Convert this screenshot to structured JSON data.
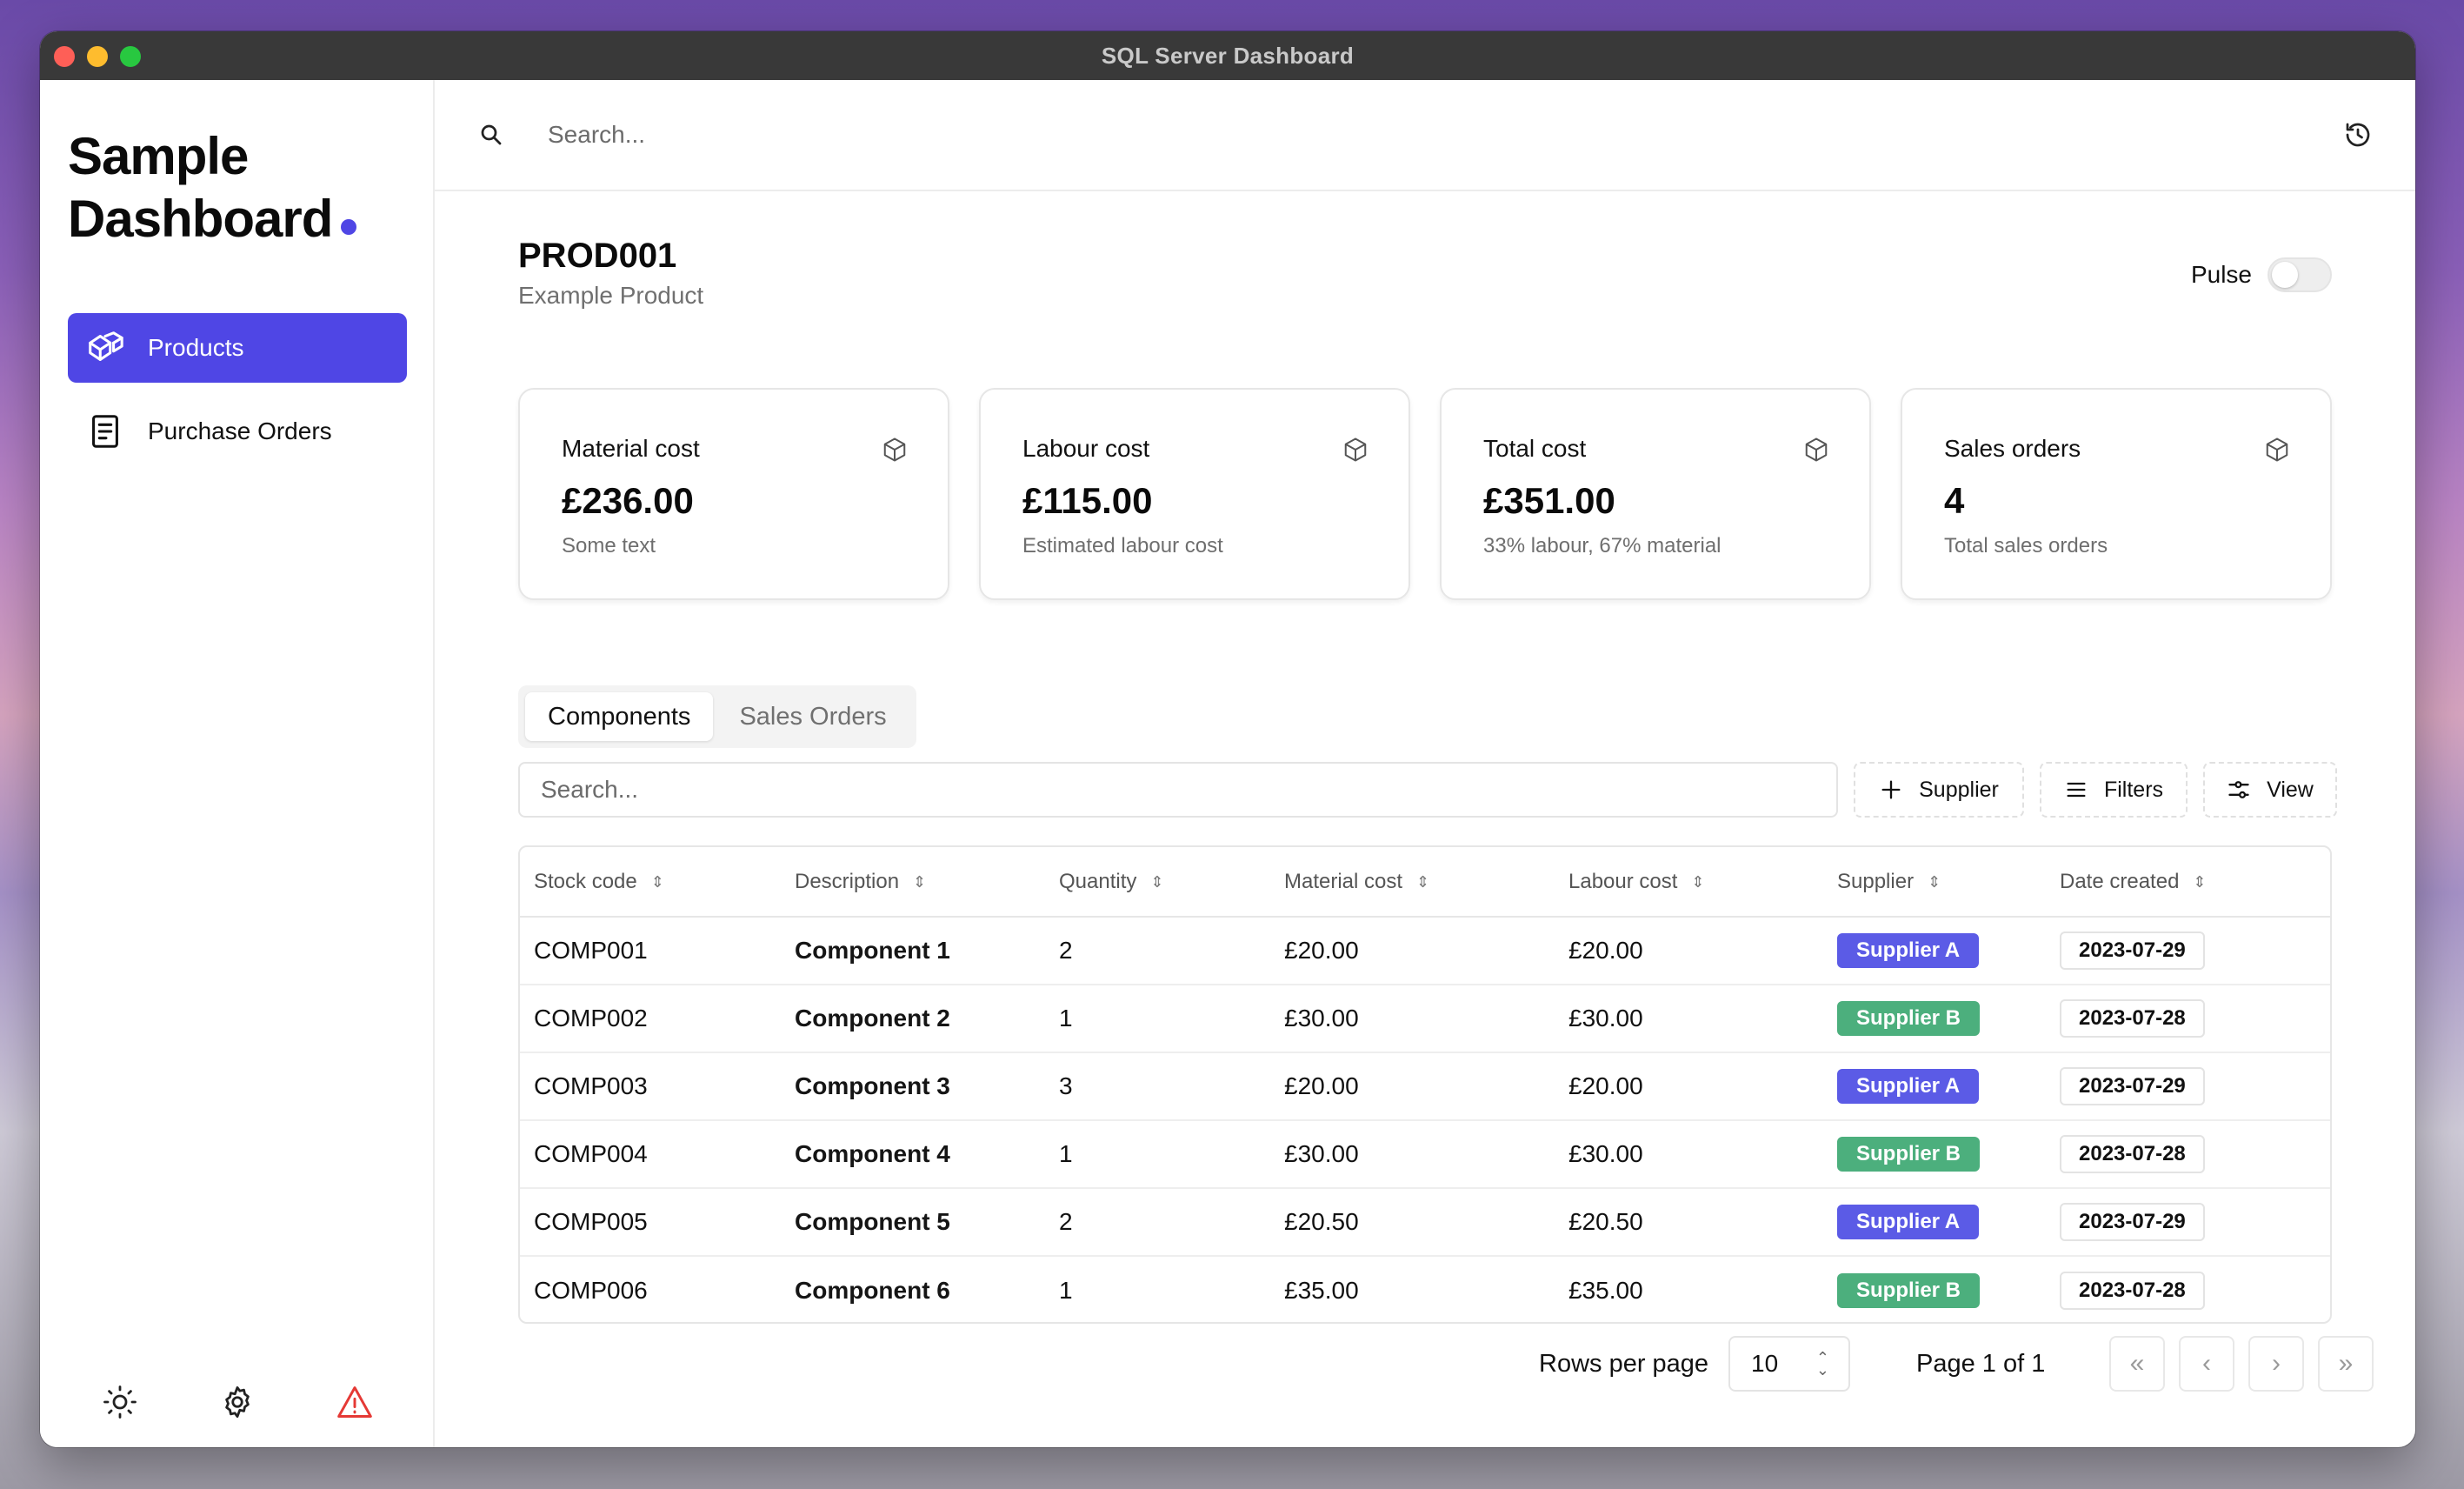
{
  "window": {
    "title": "SQL Server Dashboard"
  },
  "sidebar": {
    "brand_line1": "Sample",
    "brand_line2": "Dashboard",
    "items": [
      {
        "label": "Products",
        "icon": "box-stack-icon",
        "active": true
      },
      {
        "label": "Purchase Orders",
        "icon": "document-icon",
        "active": false
      }
    ],
    "footer_icons": [
      "sun-icon",
      "gear-icon",
      "warning-icon"
    ]
  },
  "topbar": {
    "search_placeholder": "Search..."
  },
  "product": {
    "code": "PROD001",
    "name": "Example Product",
    "pulse_label": "Pulse",
    "pulse_on": false
  },
  "cards": [
    {
      "label": "Material cost",
      "value": "£236.00",
      "sub": "Some text"
    },
    {
      "label": "Labour cost",
      "value": "£115.00",
      "sub": "Estimated labour cost"
    },
    {
      "label": "Total cost",
      "value": "£351.00",
      "sub": "33% labour, 67% material"
    },
    {
      "label": "Sales orders",
      "value": "4",
      "sub": "Total sales orders"
    }
  ],
  "tabs": [
    {
      "label": "Components",
      "active": true
    },
    {
      "label": "Sales Orders",
      "active": false
    }
  ],
  "table_tools": {
    "search_placeholder": "Search...",
    "supplier_label": "Supplier",
    "filters_label": "Filters",
    "view_label": "View"
  },
  "table": {
    "columns": [
      "Stock code",
      "Description",
      "Quantity",
      "Material cost",
      "Labour cost",
      "Supplier",
      "Date created"
    ],
    "rows": [
      {
        "code": "COMP001",
        "desc": "Component 1",
        "qty": "2",
        "mat": "£20.00",
        "lab": "£20.00",
        "supplier": "Supplier A",
        "date": "2023-07-29"
      },
      {
        "code": "COMP002",
        "desc": "Component 2",
        "qty": "1",
        "mat": "£30.00",
        "lab": "£30.00",
        "supplier": "Supplier B",
        "date": "2023-07-28"
      },
      {
        "code": "COMP003",
        "desc": "Component 3",
        "qty": "3",
        "mat": "£20.00",
        "lab": "£20.00",
        "supplier": "Supplier A",
        "date": "2023-07-29"
      },
      {
        "code": "COMP004",
        "desc": "Component 4",
        "qty": "1",
        "mat": "£30.00",
        "lab": "£30.00",
        "supplier": "Supplier B",
        "date": "2023-07-28"
      },
      {
        "code": "COMP005",
        "desc": "Component 5",
        "qty": "2",
        "mat": "£20.50",
        "lab": "£20.50",
        "supplier": "Supplier A",
        "date": "2023-07-29"
      },
      {
        "code": "COMP006",
        "desc": "Component 6",
        "qty": "1",
        "mat": "£35.00",
        "lab": "£35.00",
        "supplier": "Supplier B",
        "date": "2023-07-28"
      }
    ]
  },
  "pagination": {
    "rows_per_page_label": "Rows per page",
    "rows_per_page": "10",
    "page_label": "Page 1 of 1"
  },
  "colors": {
    "accent": "#4f46e5",
    "supplier_a": "#5b5be6",
    "supplier_b": "#4caf7d"
  }
}
